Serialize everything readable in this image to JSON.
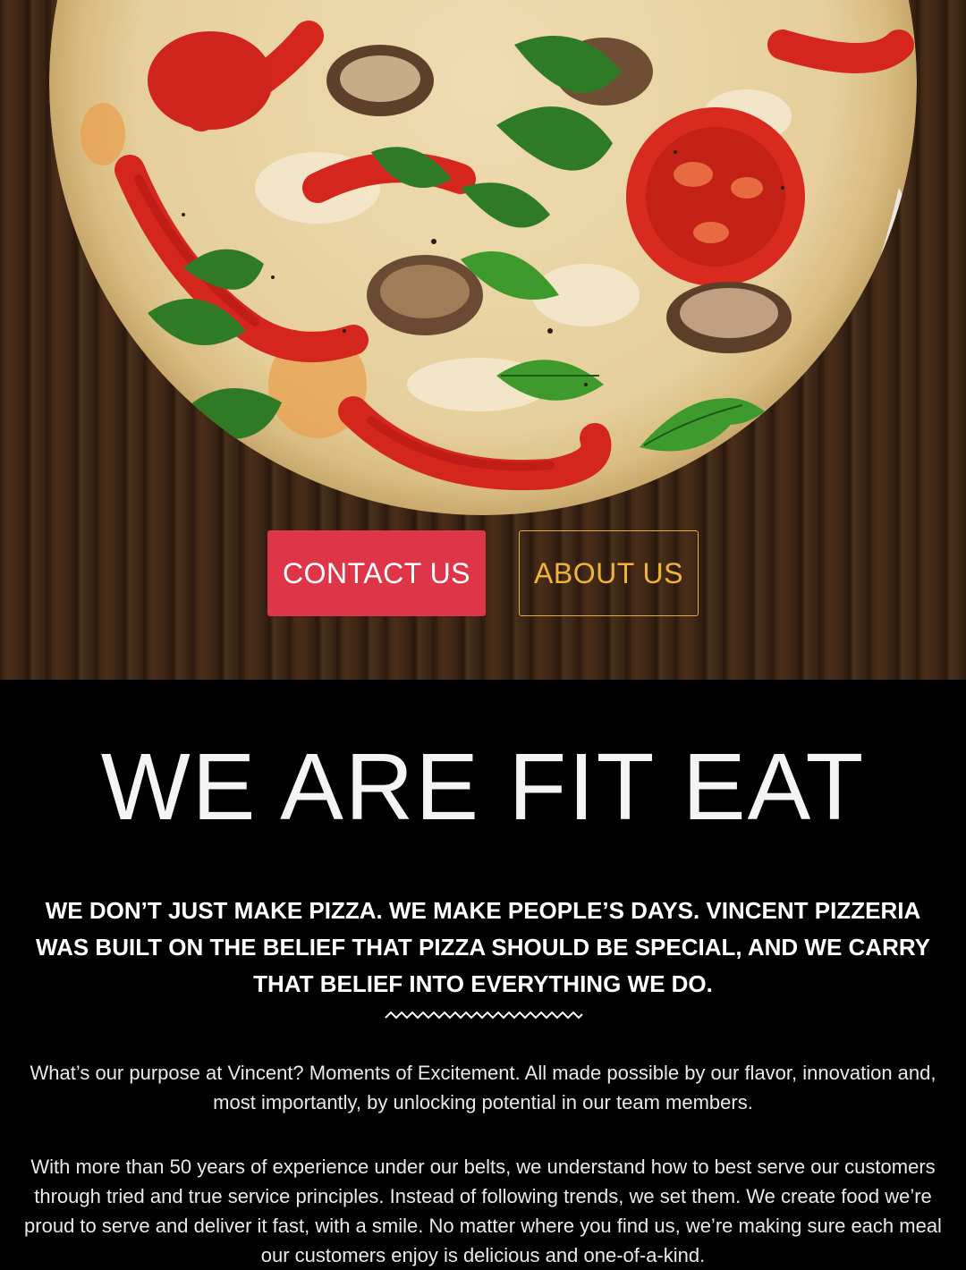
{
  "hero": {
    "buttons": {
      "contact_label": "CONTACT US",
      "about_label": "ABOUT US"
    }
  },
  "about": {
    "title": "WE ARE FIT EAT",
    "tagline": "WE DON’T JUST MAKE PIZZA. WE MAKE PEOPLE’S DAYS. VINCENT PIZZERIA WAS BUILT ON THE BELIEF THAT PIZZA SHOULD BE SPECIAL, AND WE CARRY THAT BELIEF INTO EVERYTHING WE DO.",
    "paragraphs": [
      "What’s our purpose at Vincent? Moments of Excitement. All made possible by our flavor, innovation and, most importantly, by unlocking potential in our team members.",
      "With more than 50 years of experience under our belts, we understand how to best serve our customers through tried and true service principles. Instead of following trends, we set them. We create food we’re proud to serve and deliver it fast, with a smile. No matter where you find us, we’re making sure each meal our customers enjoy is delicious and one-of-a-kind."
    ]
  },
  "colors": {
    "contact_button": "#df3548",
    "about_button_text": "#f2b33a",
    "background_dark": "#000000",
    "wood": "#3b2414"
  },
  "icons": {
    "divider": "zigzag-divider-icon",
    "hero_image": "pizza-image"
  }
}
